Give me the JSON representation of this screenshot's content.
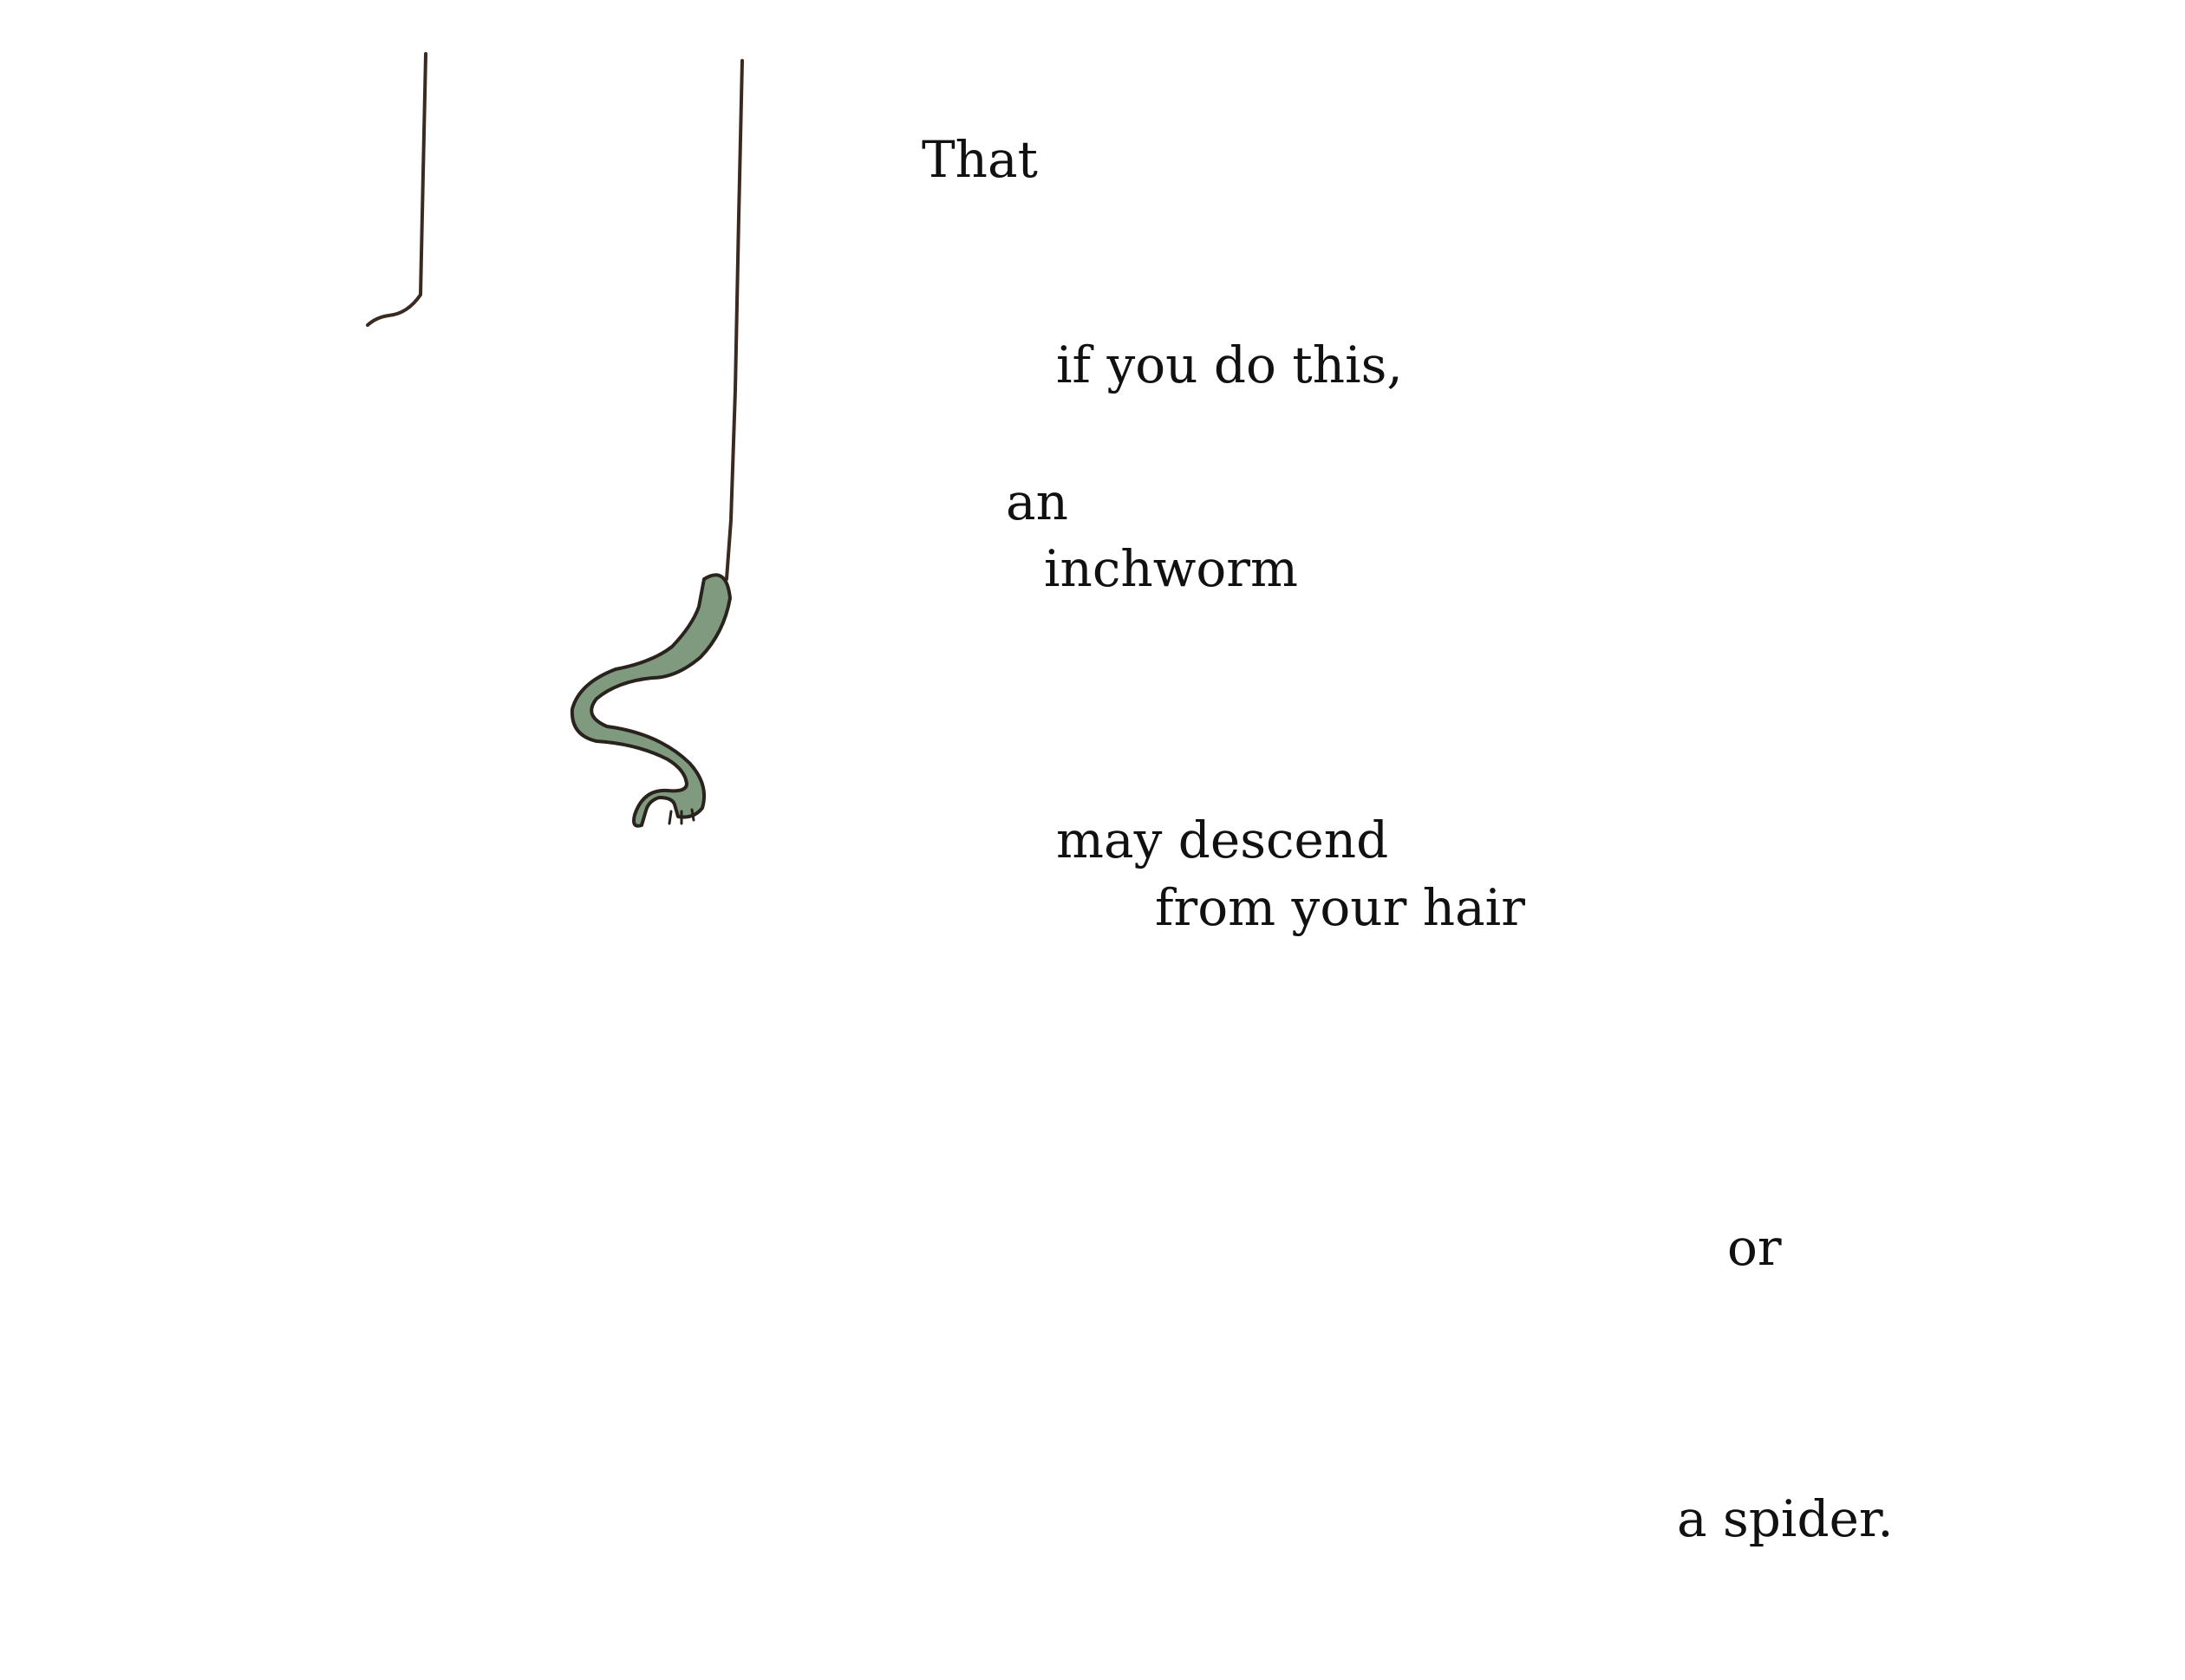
{
  "poem": {
    "lines": [
      "That",
      "if you do this,",
      "an",
      "inchworm",
      "may descend",
      "from your hair",
      "or",
      "a spider."
    ]
  },
  "illustration": {
    "subject": "inchworm-hanging-from-thread",
    "worm_fill_color": "#7f9a7e",
    "thread_color": "#3a2a22"
  }
}
